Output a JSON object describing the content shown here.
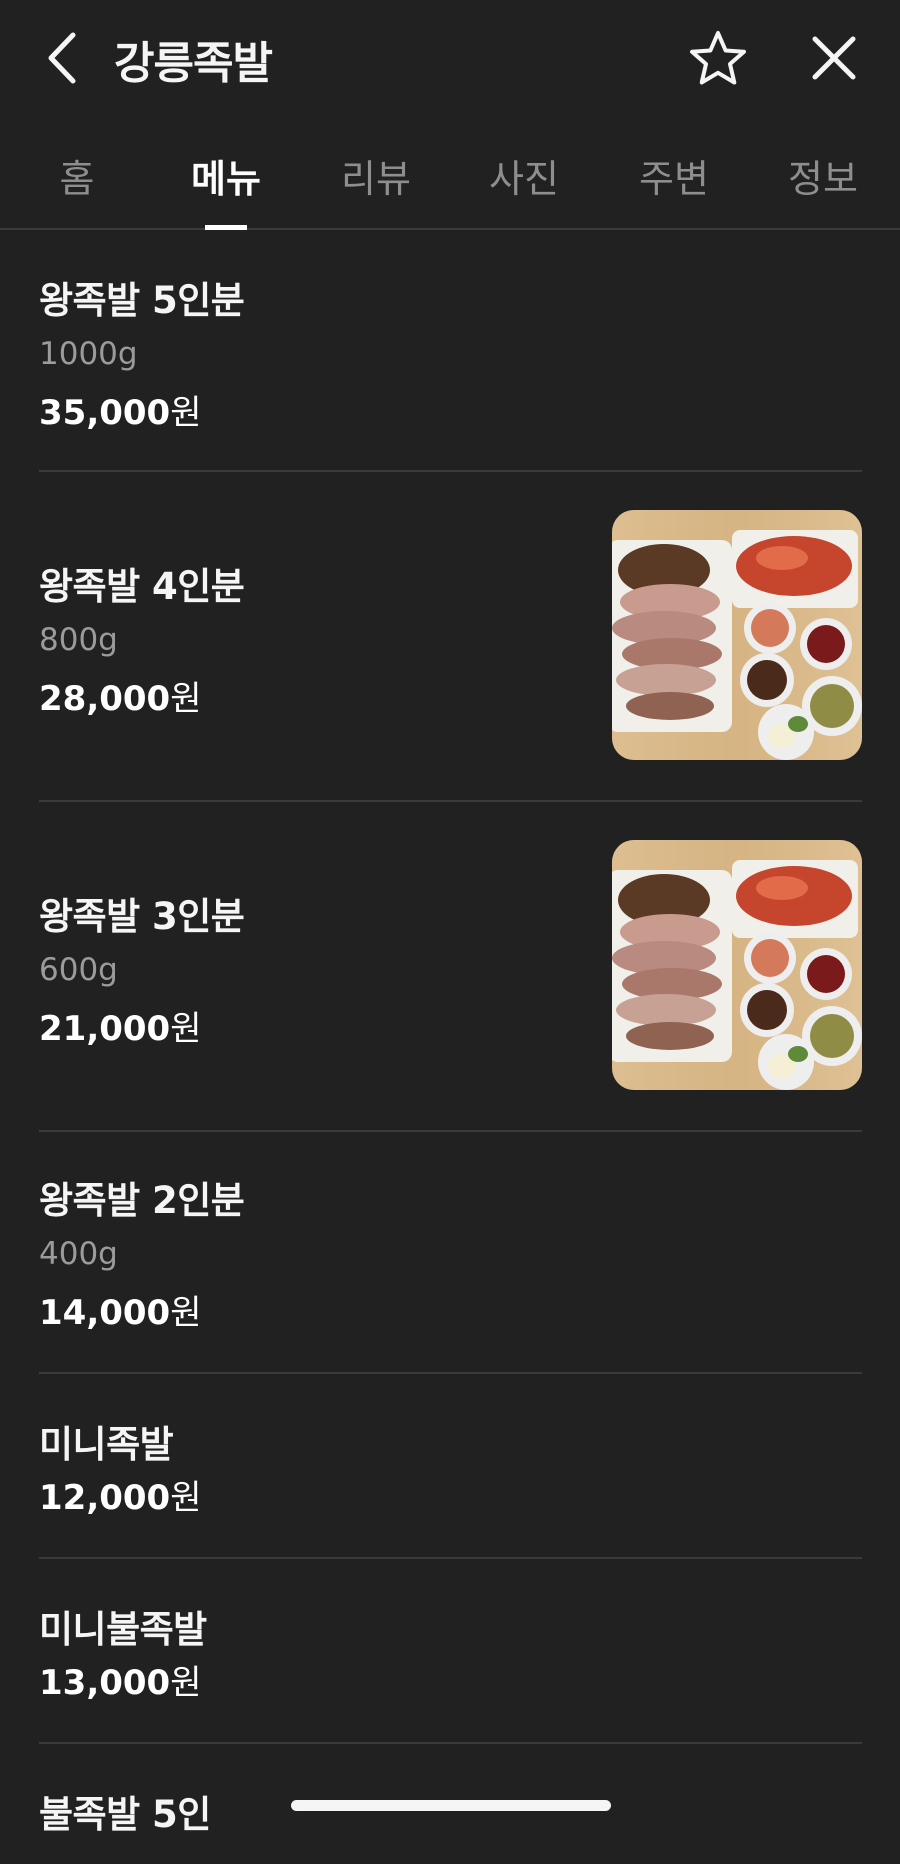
{
  "header": {
    "title": "강릉족발",
    "back_icon": "chevron-left-icon",
    "favorite_icon": "star-outline-icon",
    "close_icon": "close-icon"
  },
  "tabs": [
    {
      "label": "홈",
      "active": false
    },
    {
      "label": "메뉴",
      "active": true
    },
    {
      "label": "리뷰",
      "active": false
    },
    {
      "label": "사진",
      "active": false
    },
    {
      "label": "주변",
      "active": false
    },
    {
      "label": "정보",
      "active": false
    }
  ],
  "menu": [
    {
      "name": "왕족발 5인분",
      "weight": "1000g",
      "price": "35,000",
      "unit": "원",
      "has_photo": false
    },
    {
      "name": "왕족발 4인분",
      "weight": "800g",
      "price": "28,000",
      "unit": "원",
      "has_photo": true
    },
    {
      "name": "왕족발 3인분",
      "weight": "600g",
      "price": "21,000",
      "unit": "원",
      "has_photo": true
    },
    {
      "name": "왕족발 2인분",
      "weight": "400g",
      "price": "14,000",
      "unit": "원",
      "has_photo": false
    },
    {
      "name": "미니족발",
      "price": "12,000",
      "unit": "원",
      "has_photo": false
    },
    {
      "name": "미니불족발",
      "price": "13,000",
      "unit": "원",
      "has_photo": false
    },
    {
      "name": "불족발 5인"
    }
  ],
  "colors": {
    "background": "#212121",
    "divider": "#3a3a3a",
    "text_primary": "#f5f5f5",
    "text_secondary": "#9b9b9b"
  }
}
